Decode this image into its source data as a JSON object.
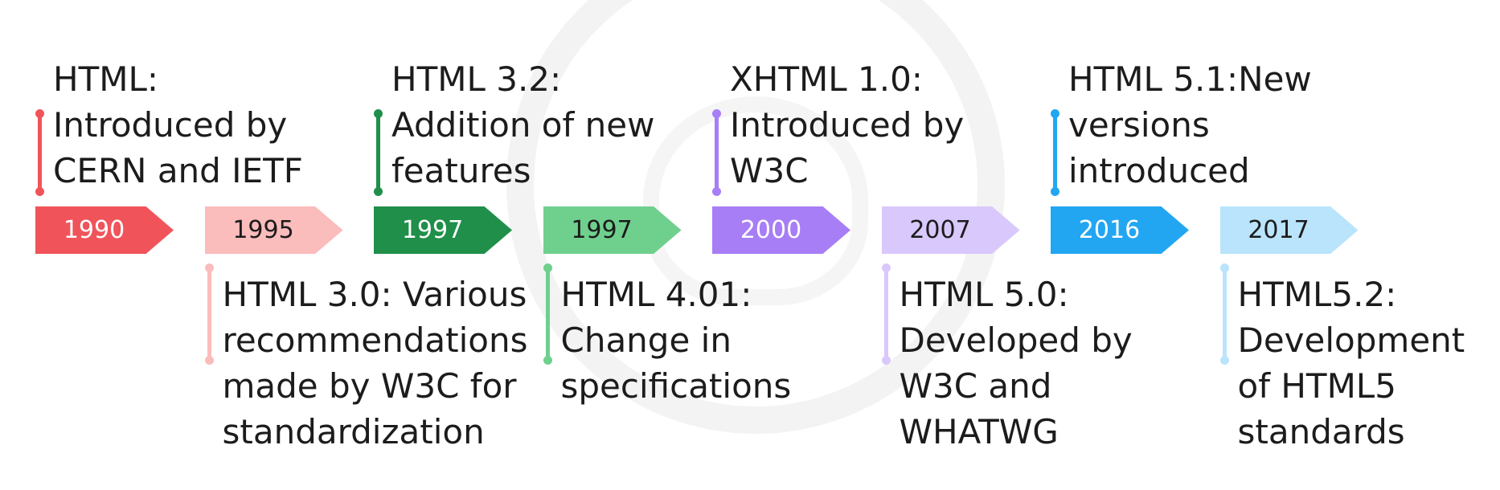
{
  "timeline": [
    {
      "year": "1990",
      "color": "#f0545a",
      "text_color": "#ffffff",
      "lines": [
        "HTML:",
        "Introduced by",
        "CERN and IETF"
      ],
      "position": "top"
    },
    {
      "year": "1995",
      "color": "#fbbcbc",
      "text_color": "#1c1c1c",
      "lines": [
        "HTML 3.0: Various",
        "recommendations",
        "made by W3C for",
        "standardization"
      ],
      "position": "bottom"
    },
    {
      "year": "1997",
      "color": "#1f8f4a",
      "text_color": "#ffffff",
      "lines": [
        "HTML 3.2:",
        "Addition of new",
        "features"
      ],
      "position": "top"
    },
    {
      "year": "1997",
      "color": "#6fd08e",
      "text_color": "#1c1c1c",
      "lines": [
        "HTML 4.01:",
        "Change in",
        "specifications"
      ],
      "position": "bottom"
    },
    {
      "year": "2000",
      "color": "#a77ef5",
      "text_color": "#ffffff",
      "lines": [
        "XHTML 1.0:",
        "Introduced by",
        "W3C"
      ],
      "position": "top"
    },
    {
      "year": "2007",
      "color": "#d9c8fb",
      "text_color": "#1c1c1c",
      "lines": [
        "HTML 5.0:",
        "Developed by",
        "W3C and",
        "WHATWG"
      ],
      "position": "bottom"
    },
    {
      "year": "2016",
      "color": "#22a6f2",
      "text_color": "#ffffff",
      "lines": [
        "HTML 5.1:New",
        "versions",
        "introduced"
      ],
      "position": "top"
    },
    {
      "year": "2017",
      "color": "#b9e4fb",
      "text_color": "#1c1c1c",
      "lines": [
        "HTML5.2:",
        "Development",
        "of HTML5",
        "standards"
      ],
      "position": "bottom"
    }
  ]
}
